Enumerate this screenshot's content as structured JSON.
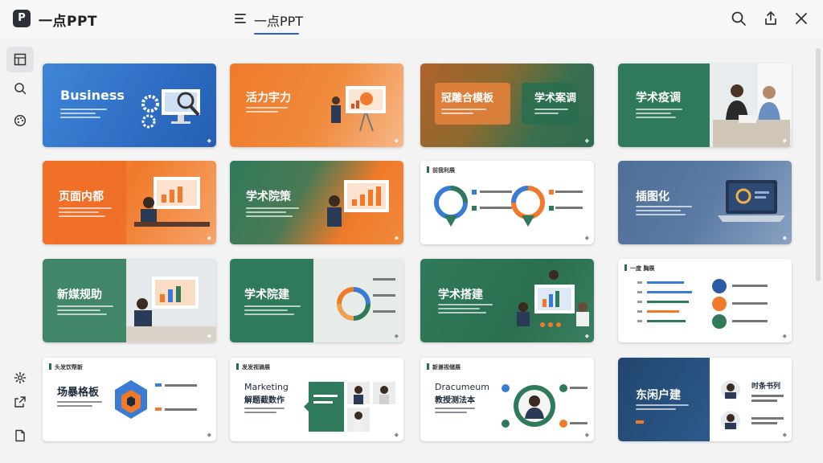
{
  "app": {
    "logo_letter": "P",
    "title": "一点PPT"
  },
  "header": {
    "tab_label": "一点PPT"
  },
  "actions": [
    "search-icon",
    "share-icon",
    "close-icon"
  ],
  "rail": {
    "top": [
      "grid-icon",
      "search-icon",
      "palette-icon"
    ],
    "bottom": [
      "settings-icon",
      "export-icon",
      "file-icon"
    ]
  },
  "cards": [
    {
      "title": "Business"
    },
    {
      "title": "活力宇力"
    },
    {
      "title": "冠雕合模板",
      "title2": "学术案调"
    },
    {
      "title": "学术疫调"
    },
    {
      "title": "页面内都"
    },
    {
      "title": "学术院策"
    },
    {
      "head": "前我利展"
    },
    {
      "title": "插图化"
    },
    {
      "title": "新媒规助"
    },
    {
      "title": "学术院建"
    },
    {
      "title": "学术搭建"
    },
    {
      "head": "一度 胸展"
    },
    {
      "head": "头发饮帮新",
      "title": "场暴格板"
    },
    {
      "head": "发发视骑展",
      "title": "Marketing",
      "title2": "解题截数作"
    },
    {
      "head": "新兼视储展",
      "title": "Dracumeum",
      "title2": "教授测法本"
    },
    {
      "title": "东闲户建",
      "title2": "时条书列"
    }
  ],
  "colors": {
    "accent": "#2b63c9",
    "blue": "#3a7bd5",
    "orange": "#f07a2a",
    "green": "#2f7a5a",
    "navy": "#22466f"
  }
}
